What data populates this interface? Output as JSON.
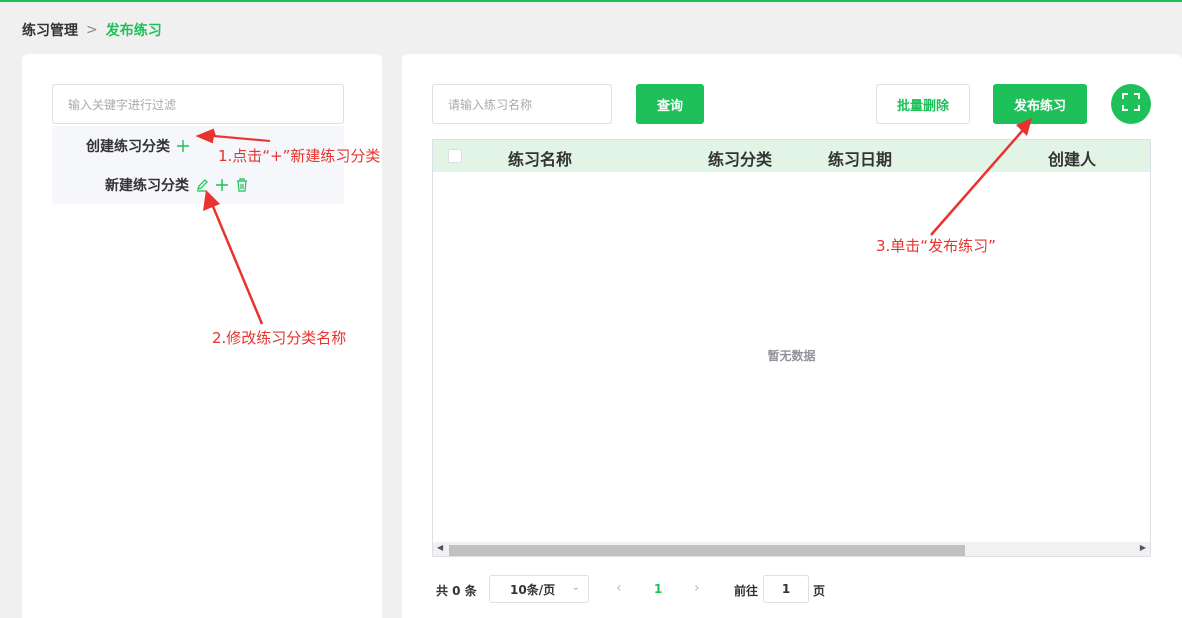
{
  "breadcrumb": {
    "parent": "练习管理",
    "separator": ">",
    "current": "发布练习"
  },
  "left_panel": {
    "filter_placeholder": "输入关键字进行过滤",
    "tree": [
      {
        "label": "创建练习分类",
        "icons": [
          "plus-icon"
        ]
      },
      {
        "label": "新建练习分类",
        "icons": [
          "edit-icon",
          "plus-icon",
          "delete-icon"
        ]
      }
    ]
  },
  "toolbar": {
    "search_placeholder": "请输入练习名称",
    "query_label": "查询",
    "batch_delete_label": "批量删除",
    "publish_label": "发布练习",
    "fullscreen_icon": "fullscreen-icon"
  },
  "table": {
    "columns": [
      "练习名称",
      "练习分类",
      "练习日期",
      "创建人"
    ],
    "empty_text": "暂无数据"
  },
  "pagination": {
    "total": "共 0 条",
    "page_size": "10条/页",
    "current_page": "1",
    "goto_label": "前往",
    "goto_value": "1",
    "goto_suffix": "页"
  },
  "annotations": {
    "step1": "1.点击“+”新建练习分类",
    "step2": "2.修改练习分类名称",
    "step3": "3.单击“发布练习”"
  },
  "colors": {
    "accent": "#1ec05a",
    "annotation": "#e8332e",
    "header_bg": "#e2f4e5"
  }
}
